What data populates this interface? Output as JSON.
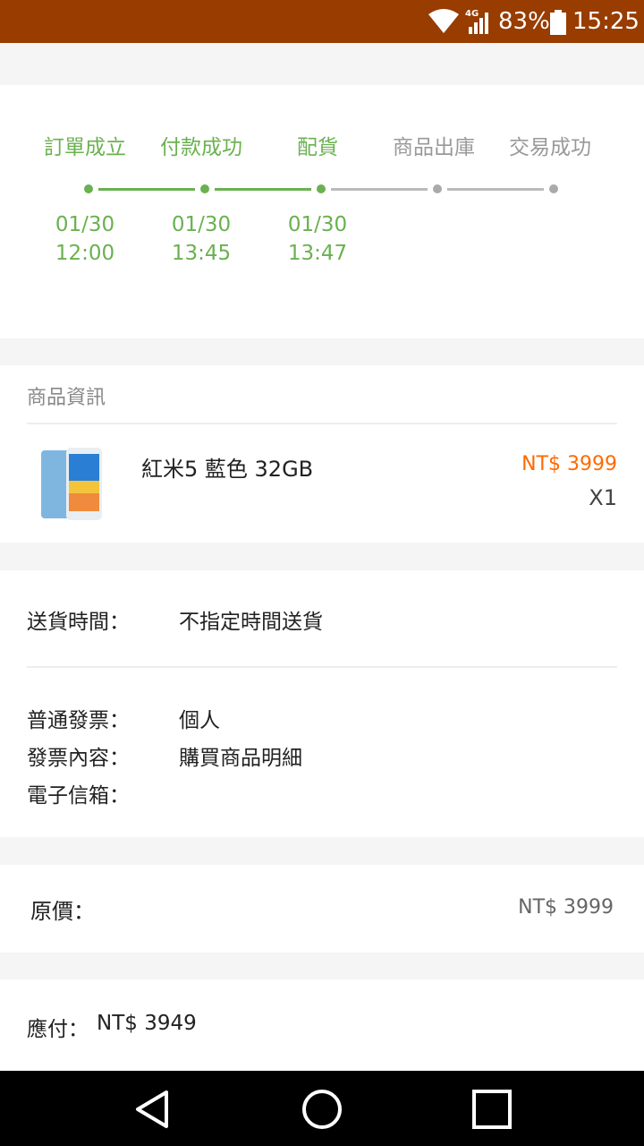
{
  "status_bar": {
    "network": "4G",
    "battery_percent": "83%",
    "time": "15:25",
    "color": "#983c00"
  },
  "progress": {
    "steps": [
      {
        "label": "訂單成立",
        "date": "01/30",
        "time": "12:00",
        "done": true
      },
      {
        "label": "付款成功",
        "date": "01/30",
        "time": "13:45",
        "done": true
      },
      {
        "label": "配貨",
        "date": "01/30",
        "time": "13:47",
        "done": true
      },
      {
        "label": "商品出庫",
        "date": "",
        "time": "",
        "done": false
      },
      {
        "label": "交易成功",
        "date": "",
        "time": "",
        "done": false
      }
    ],
    "done_color": "#6ab150"
  },
  "product_section": {
    "title": "商品資訊",
    "item": {
      "name": "紅米5 藍色 32GB",
      "price": "NT$ 3999",
      "quantity": "X1",
      "image_icon": "phone-image"
    }
  },
  "delivery": {
    "time_label": "送貨時間：",
    "time_value": "不指定時間送貨"
  },
  "invoice": {
    "type_label": "普通發票：",
    "type_value": "個人",
    "content_label": "發票內容：",
    "content_value": "購買商品明細",
    "email_label": "電子信箱：",
    "email_value": ""
  },
  "price": {
    "original_label": "原價：",
    "original_value": "NT$ 3999",
    "payable_label": "應付：",
    "payable_value": "NT$ 3949"
  },
  "nav": {
    "back": "back-icon",
    "home": "home-icon",
    "recents": "recents-icon"
  }
}
